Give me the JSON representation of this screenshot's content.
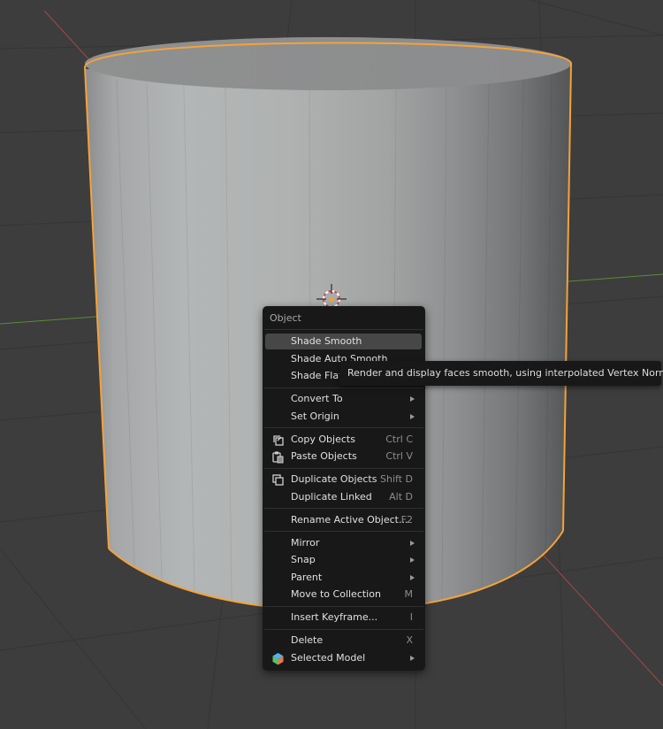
{
  "menu": {
    "title": "Object",
    "items": [
      {
        "label": "Shade Smooth",
        "shortcut": ""
      },
      {
        "label": "Shade Auto Smooth",
        "shortcut": ""
      },
      {
        "label": "Shade Flat",
        "shortcut": ""
      },
      {
        "label": "Convert To",
        "shortcut": ""
      },
      {
        "label": "Set Origin",
        "shortcut": ""
      },
      {
        "label": "Copy Objects",
        "shortcut": "Ctrl C"
      },
      {
        "label": "Paste Objects",
        "shortcut": "Ctrl V"
      },
      {
        "label": "Duplicate Objects",
        "shortcut": "Shift D"
      },
      {
        "label": "Duplicate Linked",
        "shortcut": "Alt D"
      },
      {
        "label": "Rename Active Object...",
        "shortcut": "F2"
      },
      {
        "label": "Mirror",
        "shortcut": ""
      },
      {
        "label": "Snap",
        "shortcut": ""
      },
      {
        "label": "Parent",
        "shortcut": ""
      },
      {
        "label": "Move to Collection",
        "shortcut": "M"
      },
      {
        "label": "Insert Keyframe...",
        "shortcut": "I"
      },
      {
        "label": "Delete",
        "shortcut": "X"
      },
      {
        "label": "Selected Model",
        "shortcut": ""
      }
    ]
  },
  "tooltip": {
    "text": "Render and display faces smooth, using interpolated Vertex Normals."
  },
  "colors": {
    "background": "#3d3d3d",
    "selection_outline": "#f5a23a",
    "menu_bg": "#181818",
    "highlight": "#474747",
    "axis_x": "#a24848",
    "axis_y": "#5b8c34"
  },
  "icons": [
    "copy-icon",
    "paste-icon",
    "duplicate-icon",
    "addon-cube-icon",
    "3d-cursor-icon"
  ]
}
